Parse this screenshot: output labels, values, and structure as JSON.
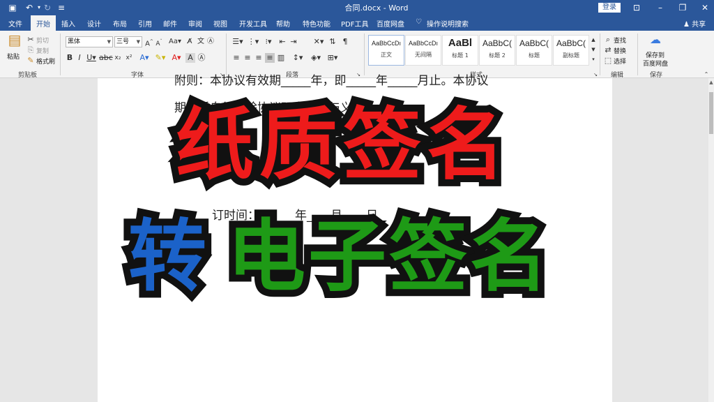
{
  "window": {
    "title": "合同.docx - Word",
    "login_label": "登录"
  },
  "tabs": [
    "文件",
    "开始",
    "插入",
    "设计",
    "布局",
    "引用",
    "邮件",
    "审阅",
    "视图",
    "开发工具",
    "帮助",
    "特色功能",
    "PDF工具",
    "百度网盘",
    "操作说明搜索"
  ],
  "share_label": "共享",
  "ribbon": {
    "clipboard": {
      "paste": "粘贴",
      "cut": "剪切",
      "copy": "复制",
      "format_painter": "格式刷",
      "label": "剪贴板"
    },
    "font": {
      "family": "黑体",
      "size": "三号",
      "label": "字体"
    },
    "paragraph": {
      "label": "段落"
    },
    "styles": {
      "label": "样式",
      "items": [
        {
          "sample": "AaBbCcDı",
          "name": "正文"
        },
        {
          "sample": "AaBbCcDı",
          "name": "无间隔"
        },
        {
          "sample": "AaBl",
          "name": "标题 1"
        },
        {
          "sample": "AaBbC(",
          "name": "标题 2"
        },
        {
          "sample": "AaBbC(",
          "name": "标题"
        },
        {
          "sample": "AaBbC(",
          "name": "副标题"
        }
      ]
    },
    "editing": {
      "find": "查找",
      "replace": "替换",
      "select": "选择",
      "label": "编辑"
    },
    "save": {
      "line1": "保存到",
      "line2": "百度网盘",
      "label": "保存"
    }
  },
  "document": {
    "lines": [
      "附则：本协议有效期_____年，即_____年_____月止。本协议",
      "期满后自行解除协议双方权利与义务。",
      "订时间：______年____月____日"
    ]
  },
  "overlay": {
    "line1": "纸质签名",
    "line2_a": "转",
    "line2_b": "电子签名"
  },
  "colors": {
    "title_bar": "#2b579a",
    "overlay_red": "#ee1b1b",
    "overlay_blue": "#1b62c9",
    "overlay_green": "#1e9a16"
  }
}
